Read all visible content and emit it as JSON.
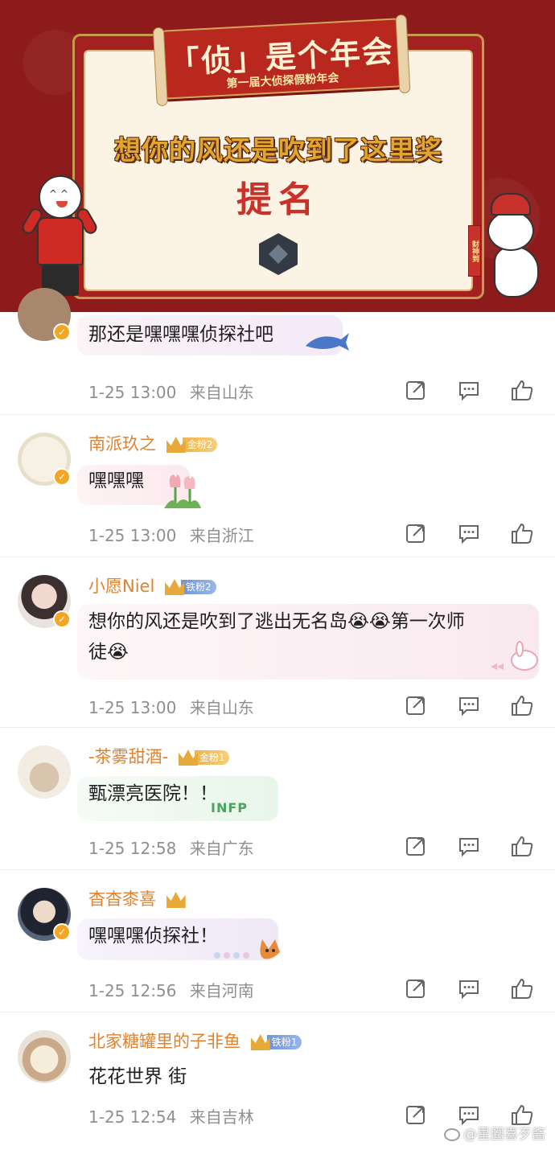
{
  "banner": {
    "title": "「侦」是个年会",
    "subtitle": "第一届大侦探假粉年会",
    "award": "想你的风还是吹到了这里奖",
    "nominate": "提名",
    "right_scroll": "财神到"
  },
  "comments": [
    {
      "username": "",
      "fan_level": "",
      "text": "那还是嘿嘿嘿侦探社吧",
      "time": "1-25 13:00",
      "location": "来自山东"
    },
    {
      "username": "南派玖之",
      "fan_level": "金粉2",
      "text": "嘿嘿嘿",
      "time": "1-25 13:00",
      "location": "来自浙江"
    },
    {
      "username": "小愿Niel",
      "fan_level": "铁粉2",
      "text_line1": "想你的风还是吹到了逃出无名岛😭😭第一次师",
      "text_line2": "徒😭",
      "time": "1-25 13:00",
      "location": "来自山东"
    },
    {
      "username": "-茶雾甜酒-",
      "fan_level": "金粉1",
      "text": "甄漂亮医院！！",
      "time": "1-25 12:58",
      "location": "来自广东",
      "sticker_text": "INFP"
    },
    {
      "username": "杳杳桼喜",
      "fan_level": "",
      "text": "嘿嘿嘿侦探社！",
      "time": "1-25 12:56",
      "location": "来自河南"
    },
    {
      "username": "北家糖罐里的子非鱼",
      "fan_level": "铁粉1",
      "text": "花花世界 街",
      "time": "1-25 12:54",
      "location": "来自吉林"
    }
  ],
  "watermark": "@星圈喜歹酱",
  "colors": {
    "username": "#e0822f",
    "meta": "#8f8f8f",
    "banner_red": "#8e1b1b",
    "gold": "#e3a62c"
  },
  "icons": {
    "share": "share-icon",
    "reply": "comment-icon",
    "like": "thumbs-up-icon",
    "verified": "verified-badge-icon"
  }
}
